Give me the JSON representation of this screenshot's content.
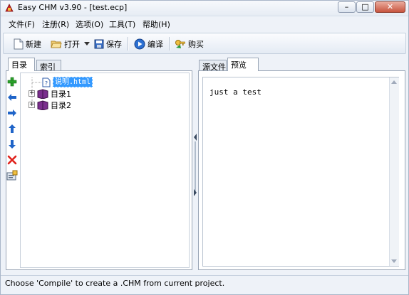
{
  "window": {
    "title": "Easy CHM v3.90 - [test.ecp]",
    "min_label": "–",
    "max_label": "□",
    "close_label": "✕"
  },
  "menubar": {
    "items": [
      "文件(F)",
      "注册(R)",
      "选项(O)",
      "工具(T)",
      "帮助(H)"
    ]
  },
  "toolbar": {
    "new_label": "新建",
    "open_label": "打开",
    "save_label": "保存",
    "compile_label": "编译",
    "buy_label": "购买"
  },
  "left_tabs": [
    "目录",
    "索引"
  ],
  "right_tabs": [
    "源文件",
    "预览"
  ],
  "tree": {
    "items": [
      {
        "label": "说明.html",
        "selected": true
      },
      {
        "label": "目录1"
      },
      {
        "label": "目录2"
      }
    ]
  },
  "preview": {
    "text": "just a test"
  },
  "status": {
    "text": "Choose 'Compile' to create a .CHM from current project."
  },
  "colors": {
    "selection": "#3399ff",
    "add": "#2aa12a",
    "arrow": "#1f64c8",
    "delete": "#e0201a"
  },
  "icons": {
    "left_tools": [
      "add-icon",
      "move-left-icon",
      "move-right-icon",
      "move-up-icon",
      "move-down-icon",
      "delete-icon",
      "properties-icon"
    ]
  }
}
